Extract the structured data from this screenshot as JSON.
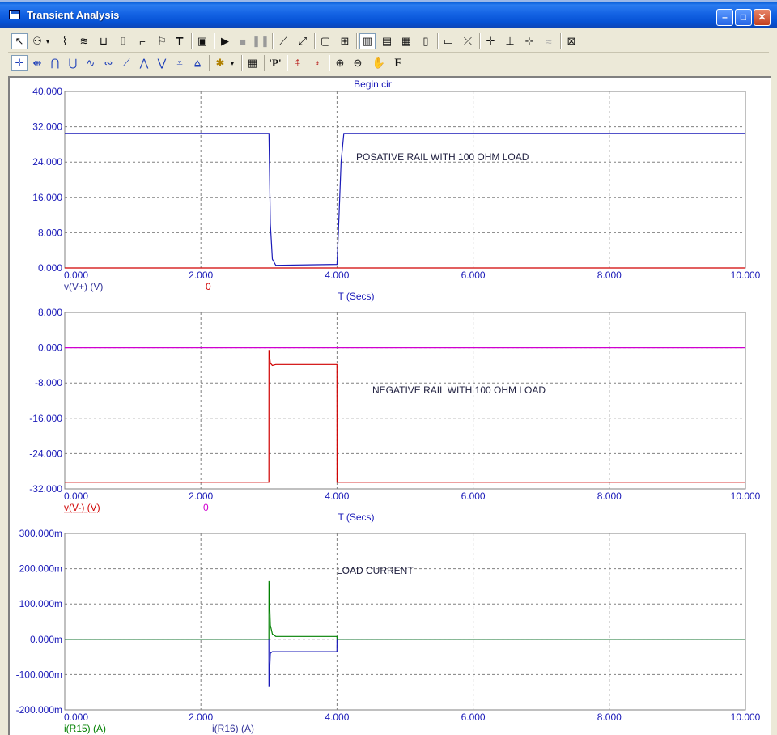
{
  "window": {
    "title": "Transient Analysis"
  },
  "icons": {
    "toolbar1": [
      "select-arrow-icon",
      "component-icon",
      "dropdown-icon",
      "wire-icon",
      "bus-icon",
      "node-icon",
      "text-icon",
      "label-icon",
      "flag-icon",
      "text-t-icon",
      "page-icon",
      "run-icon",
      "stop-icon",
      "pause-icon",
      "line-icon",
      "diagonal-line-icon",
      "box-icon",
      "grid-icon",
      "vertical-grid-icon",
      "horizontal-grid-icon",
      "minor-grid-icon",
      "major-grid-icon",
      "axis-icon",
      "cursor-icon",
      "scope-icon",
      "tag-icon",
      "tag2-icon",
      "peak-icon",
      "properties-icon"
    ],
    "toolbar2": [
      "crosshair-icon",
      "cursor-horizontal-icon",
      "peak-icon",
      "valley-icon",
      "high-icon",
      "low-icon",
      "inflection-icon",
      "rise-icon",
      "fall-icon",
      "global-high-icon",
      "global-low-icon",
      "color-icon",
      "data-table-icon",
      "p-label-icon",
      "next-simulation-icon",
      "prev-simulation-icon",
      "zoom-in-icon",
      "zoom-out-icon",
      "pan-icon",
      "font-icon"
    ]
  },
  "chart_data": [
    {
      "type": "line",
      "title": "Begin.cir",
      "annotation": "POSATIVE RAIL WITH 100 OHM LOAD",
      "xlabel": "T (Secs)",
      "xlim": [
        0,
        10
      ],
      "ylim": [
        0,
        40
      ],
      "xticks": [
        "0.000",
        "2.000",
        "4.000",
        "6.000",
        "8.000",
        "10.000"
      ],
      "yticks": [
        "0.000",
        "8.000",
        "16.000",
        "24.000",
        "32.000",
        "40.000"
      ],
      "legend": [
        {
          "label": "v(V+) (V)",
          "color": "#333399"
        },
        {
          "label": "0",
          "color": "#d00000"
        }
      ],
      "series": [
        {
          "name": "v(V+) (V)",
          "color": "#1a1ab8",
          "x": [
            0,
            3,
            3.02,
            3.05,
            3.1,
            4.0,
            4.03,
            4.06,
            4.1,
            10
          ],
          "y": [
            30.5,
            30.5,
            10,
            2,
            0.6,
            0.8,
            12,
            24,
            30.5,
            30.5
          ]
        },
        {
          "name": "0",
          "color": "#d00000",
          "x": [
            0,
            10
          ],
          "y": [
            0,
            0
          ]
        }
      ]
    },
    {
      "type": "line",
      "annotation": "NEGATIVE RAIL WITH 100 OHM LOAD",
      "xlabel": "T (Secs)",
      "xlim": [
        0,
        10
      ],
      "ylim": [
        -32,
        8
      ],
      "xticks": [
        "0.000",
        "2.000",
        "4.000",
        "6.000",
        "8.000",
        "10.000"
      ],
      "yticks": [
        "-32.000",
        "-24.000",
        "-16.000",
        "-8.000",
        "0.000",
        "8.000"
      ],
      "legend": [
        {
          "label": "v(V-) (V)",
          "color": "#d00000"
        },
        {
          "label": "0",
          "color": "#d000d0"
        }
      ],
      "series": [
        {
          "name": "v(V-) (V)",
          "color": "#d00000",
          "x": [
            0,
            2.999,
            3.0,
            3.02,
            3.05,
            3.1,
            3.999,
            4.0,
            10
          ],
          "y": [
            -30.5,
            -30.5,
            -0.5,
            -3.5,
            -4.0,
            -3.8,
            -3.8,
            -30.5,
            -30.5
          ]
        },
        {
          "name": "0",
          "color": "#d000d0",
          "x": [
            0,
            10
          ],
          "y": [
            0,
            0
          ]
        }
      ]
    },
    {
      "type": "line",
      "annotation": "LOAD CURRENT",
      "xlabel": "",
      "xlim": [
        0,
        10
      ],
      "ylim": [
        -200,
        300
      ],
      "xticks": [
        "0.000",
        "2.000",
        "4.000",
        "6.000",
        "8.000",
        "10.000"
      ],
      "yticks": [
        "-200.000m",
        "-100.000m",
        "0.000m",
        "100.000m",
        "200.000m",
        "300.000m"
      ],
      "legend": [
        {
          "label": "i(R15) (A)",
          "color": "#008000"
        },
        {
          "label": "i(R16) (A)",
          "color": "#333399"
        }
      ],
      "series": [
        {
          "name": "i(R15) (A)",
          "color": "#008000",
          "x": [
            0,
            2.999,
            3.0,
            3.02,
            3.05,
            3.1,
            3.999,
            4.0,
            10
          ],
          "y": [
            0,
            0,
            165,
            40,
            15,
            8,
            8,
            0,
            0
          ]
        },
        {
          "name": "i(R16) (A)",
          "color": "#1a1ab8",
          "x": [
            0,
            2.999,
            3.0,
            3.02,
            3.05,
            3.1,
            3.999,
            4.0,
            10
          ],
          "y": [
            0,
            0,
            -135,
            -40,
            -35,
            -35,
            -35,
            0,
            0
          ]
        }
      ]
    }
  ]
}
